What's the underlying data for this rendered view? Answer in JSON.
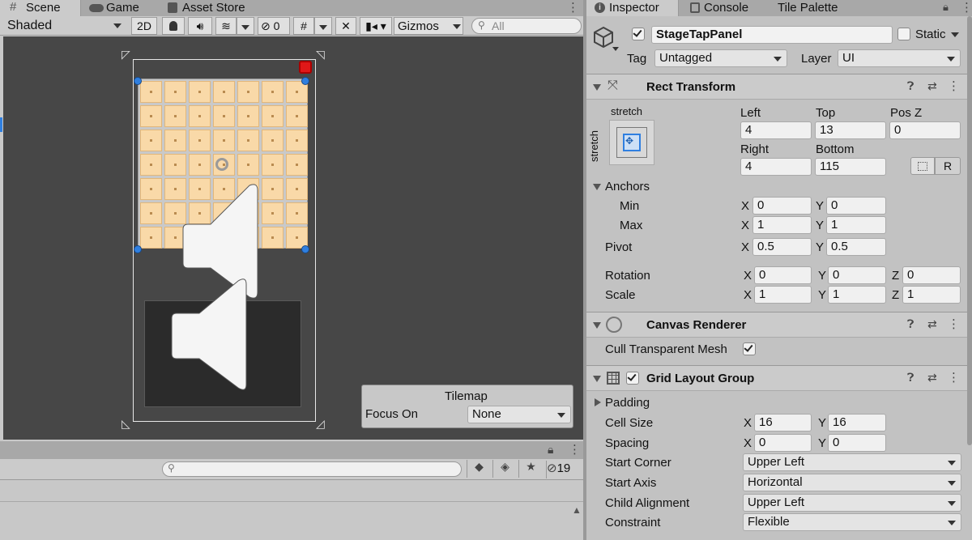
{
  "scene_window": {
    "tabs": [
      {
        "label": "Scene",
        "icon": "grid-icon"
      },
      {
        "label": "Game",
        "icon": "gamepad-icon"
      },
      {
        "label": "Asset Store",
        "icon": "store-icon"
      }
    ],
    "toolbar": {
      "shading_mode": "Shaded",
      "mode_2d": "2D",
      "hidden_count": "0",
      "gizmos_label": "Gizmos",
      "search_placeholder": "All"
    },
    "tilemap_overlay": {
      "title": "Tilemap",
      "focus_label": "Focus On",
      "focus_value": "None"
    }
  },
  "bottom_panel": {
    "layer_count": "19",
    "search_placeholder": ""
  },
  "inspector": {
    "tabs": [
      {
        "label": "Inspector",
        "icon": "info-icon"
      },
      {
        "label": "Console",
        "icon": "console-icon"
      },
      {
        "label": "Tile Palette",
        "icon": ""
      }
    ],
    "object_name": "StageTapPanel",
    "static_label": "Static",
    "tag_label": "Tag",
    "tag_value": "Untagged",
    "layer_label": "Layer",
    "layer_value": "UI",
    "rect_transform": {
      "title": "Rect Transform",
      "anchor_preset_top": "stretch",
      "anchor_preset_side": "stretch",
      "left_label": "Left",
      "left_value": "4",
      "top_label": "Top",
      "top_value": "13",
      "posz_label": "Pos Z",
      "posz_value": "0",
      "right_label": "Right",
      "right_value": "4",
      "bottom_label": "Bottom",
      "bottom_value": "115",
      "raw_button": "R",
      "anchors_label": "Anchors",
      "min_label": "Min",
      "min_x": "0",
      "min_y": "0",
      "max_label": "Max",
      "max_x": "1",
      "max_y": "1",
      "pivot_label": "Pivot",
      "pivot_x": "0.5",
      "pivot_y": "0.5",
      "rotation_label": "Rotation",
      "rot_x": "0",
      "rot_y": "0",
      "rot_z": "0",
      "scale_label": "Scale",
      "scale_x": "1",
      "scale_y": "1",
      "scale_z": "1"
    },
    "canvas_renderer": {
      "title": "Canvas Renderer",
      "cull_label": "Cull Transparent Mesh"
    },
    "grid_layout": {
      "title": "Grid Layout Group",
      "padding_label": "Padding",
      "cell_size_label": "Cell Size",
      "cell_x": "16",
      "cell_y": "16",
      "spacing_label": "Spacing",
      "spacing_x": "0",
      "spacing_y": "0",
      "start_corner_label": "Start Corner",
      "start_corner_value": "Upper Left",
      "start_axis_label": "Start Axis",
      "start_axis_value": "Horizontal",
      "child_alignment_label": "Child Alignment",
      "child_alignment_value": "Upper Left",
      "constraint_label": "Constraint",
      "constraint_value": "Flexible"
    },
    "axis_labels": {
      "x": "X",
      "y": "Y",
      "z": "Z"
    }
  },
  "colors": {
    "scene_bg": "#474747",
    "cell_fill": "#f9d9a8",
    "handle_blue": "#2f7fe0",
    "inspector_bg": "#c2c2c2"
  }
}
